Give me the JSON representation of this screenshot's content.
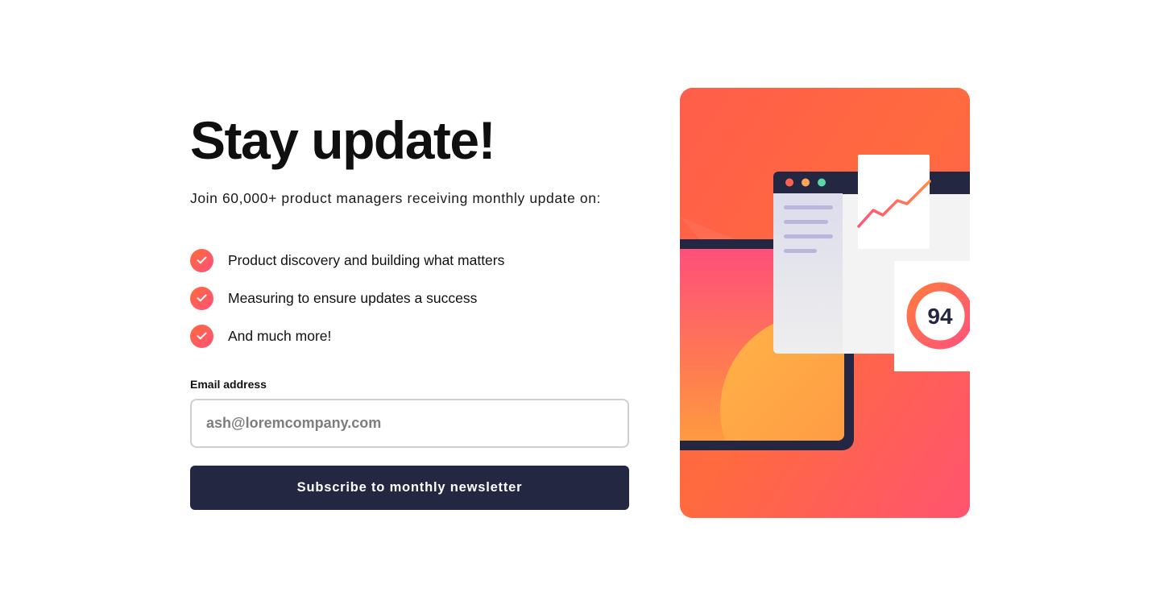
{
  "signup": {
    "title": "Stay update!",
    "subtitle": "Join 60,000+ product managers receiving monthly update on:",
    "features": [
      {
        "text": "Product discovery and building what matters"
      },
      {
        "text": "Measuring to ensure updates a success"
      },
      {
        "text": "And much more!"
      }
    ],
    "email": {
      "label": "Email address",
      "placeholder": "ash@loremcompany.com",
      "value": ""
    },
    "subscribe_label": "Subscribe to monthly newsletter"
  },
  "illustration": {
    "score": "94",
    "window_dot_colors": [
      "#ff6155",
      "#ffa35a",
      "#5ad8a4"
    ]
  },
  "colors": {
    "dark_navy": "#242742",
    "accent_orange": "#ff6a3a",
    "accent_pink": "#ff527b",
    "input_border": "#cfcfcf"
  }
}
